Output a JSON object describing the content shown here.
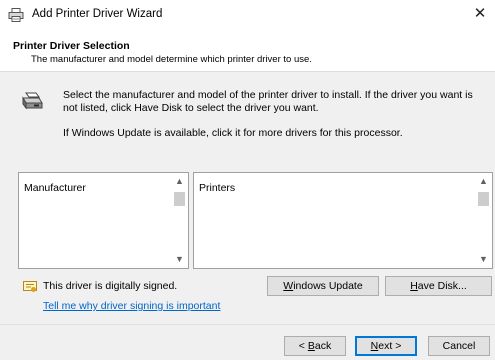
{
  "window": {
    "title": "Add Printer Driver Wizard",
    "close_glyph": "✕",
    "title_icon": "printer-icon"
  },
  "header": {
    "title": "Printer Driver Selection",
    "subtitle": "The manufacturer and model determine which printer driver to use."
  },
  "content": {
    "icon": "printer-icon",
    "description": "Select the manufacturer and model of the printer driver to install. If the driver you want is not listed, click Have Disk to select the driver you want.",
    "windows_update_note": "If Windows Update is available, click it for more drivers for this processor.",
    "manufacturer_list": {
      "header": "Manufacturer",
      "items": []
    },
    "printers_list": {
      "header": "Printers",
      "items": []
    },
    "signature_status": "This driver is digitally signed.",
    "signing_link": "Tell me why driver signing is important",
    "windows_update_button": {
      "mnemonic": "W",
      "rest": "indows Update"
    },
    "have_disk_button": {
      "mnemonic": "H",
      "rest": "ave Disk..."
    }
  },
  "footer": {
    "back_button": {
      "pre": "< ",
      "mnemonic": "B",
      "rest": "ack"
    },
    "next_button": {
      "mnemonic": "N",
      "rest": "ext >"
    },
    "cancel_button": "Cancel"
  },
  "colors": {
    "link": "#0066cc",
    "focus": "#0078d7",
    "dialog_bg": "#f0f0f0"
  }
}
